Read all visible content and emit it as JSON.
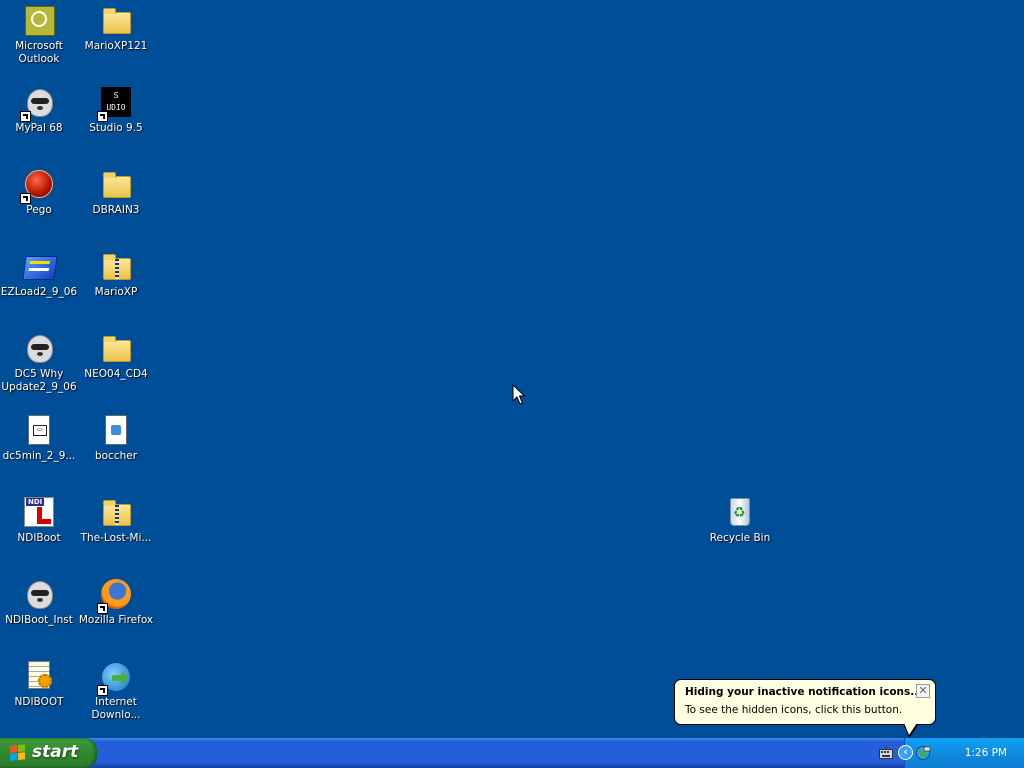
{
  "desktop": {
    "icons": [
      {
        "label": "Microsoft\nOutlook",
        "icon": "outlook-icon"
      },
      {
        "label": "MarioXP121",
        "icon": "folder-icon"
      },
      {
        "label": "MyPal 68",
        "icon": "raccoon-icon"
      },
      {
        "label": "Studio 9.5",
        "icon": "studio-icon"
      },
      {
        "label": "Pego",
        "icon": "pego-icon"
      },
      {
        "label": "DBRAIN3",
        "icon": "folder-icon"
      },
      {
        "label": "EZLoad2_9_06",
        "icon": "ezload-icon"
      },
      {
        "label": "MarioXP",
        "icon": "zip-folder-icon"
      },
      {
        "label": "DC5 Why\nUpdate2_9_06",
        "icon": "raccoon-icon"
      },
      {
        "label": "NEO04_CD4",
        "icon": "folder-icon"
      },
      {
        "label": "dc5min_2_9...",
        "icon": "file-icon"
      },
      {
        "label": "boccher",
        "icon": "media-file-icon"
      },
      {
        "label": "NDIBoot",
        "icon": "ndi-icon"
      },
      {
        "label": "The-Lost-Mi...",
        "icon": "zip-folder-icon"
      },
      {
        "label": "NDIBoot_Inst",
        "icon": "raccoon-icon"
      },
      {
        "label": "Mozilla Firefox",
        "icon": "firefox-icon"
      },
      {
        "label": "NDIBOOT",
        "icon": "notepad-icon"
      },
      {
        "label": "Internet\nDownlo...",
        "icon": "idm-icon"
      },
      {
        "label": "Recycle Bin",
        "icon": "recycle-bin-icon"
      }
    ],
    "studio_icon_text": "S\nUDIO",
    "ndi_icon_text": "NDI"
  },
  "balloon": {
    "title": "Hiding your inactive notification icons...",
    "body": "To see the hidden icons, click this button.",
    "close": "✕"
  },
  "taskbar": {
    "start_label": "start",
    "clock": "1:26 PM",
    "chevron": "‹",
    "colors": {
      "taskbar": "#245edb",
      "start": "#2f8a2f",
      "tray": "#0f8be0",
      "desktop": "#004e98"
    }
  }
}
